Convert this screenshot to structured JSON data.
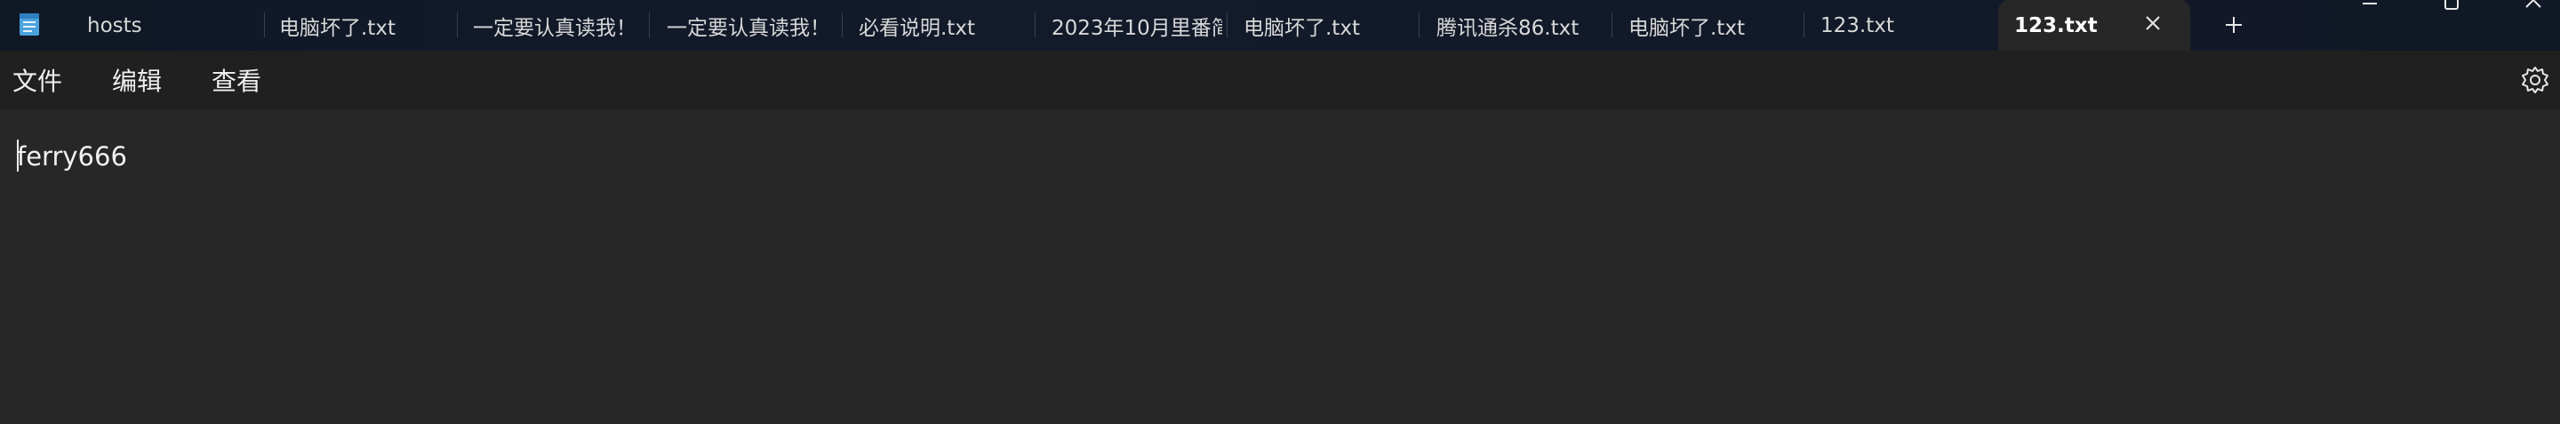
{
  "tabs": [
    {
      "label": "hosts"
    },
    {
      "label": "电脑坏了.txt"
    },
    {
      "label": "一定要认真读我！"
    },
    {
      "label": "一定要认真读我！"
    },
    {
      "label": "必看说明.txt"
    },
    {
      "label": "2023年10月里番简"
    },
    {
      "label": "电脑坏了.txt"
    },
    {
      "label": "腾讯通杀86.txt"
    },
    {
      "label": "电脑坏了.txt"
    },
    {
      "label": "123.txt"
    },
    {
      "label": "123.txt",
      "active": true
    }
  ],
  "menu": {
    "file": "文件",
    "edit": "编辑",
    "view": "查看"
  },
  "editor": {
    "content": "ferry666"
  },
  "icons": {
    "app": "notepad-icon",
    "close_tab": "close-icon",
    "new_tab": "plus-icon",
    "settings": "gear-icon",
    "minimize": "minimize-icon",
    "maximize": "maximize-icon",
    "close_window": "close-icon"
  },
  "colors": {
    "titlebar": "#111826",
    "menubar": "#202020",
    "editor_bg": "#272727",
    "text": "#f0f0f0"
  }
}
